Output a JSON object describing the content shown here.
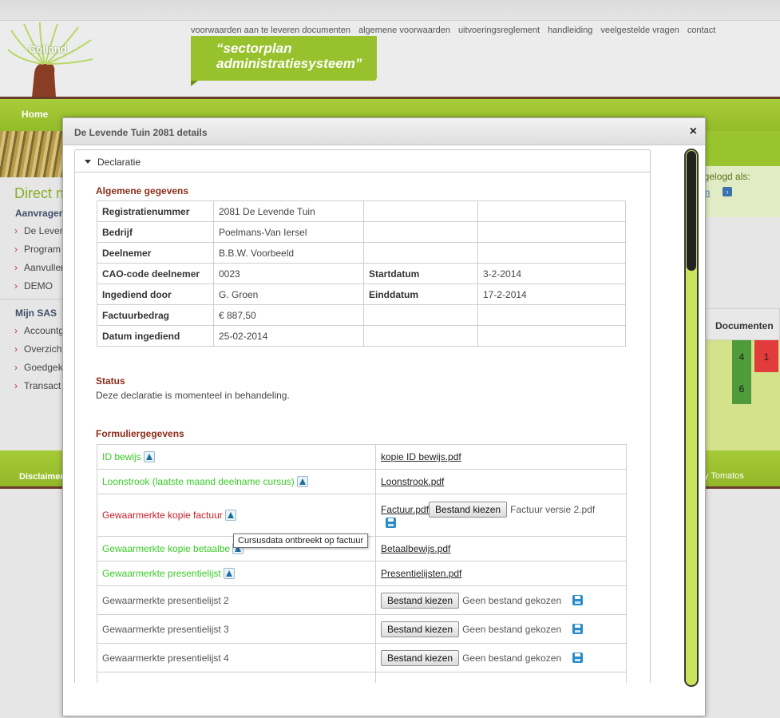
{
  "header": {
    "logo_text": "Colland",
    "topnav": [
      "voorwaarden aan te leveren documenten",
      "algemene voorwaarden",
      "uitvoeringsreglement",
      "handleiding",
      "veelgestelde vragen",
      "contact"
    ],
    "banner_line1": "“sectorplan",
    "banner_line2": "administratiesysteem”",
    "home": "Home"
  },
  "sidebar": {
    "title": "Direct n",
    "group1_head": "Aanvragen",
    "group1_items": [
      "De Leven",
      "Program",
      "Aanvuller",
      "DEMO"
    ],
    "group2_head": "Mijn SAS",
    "group2_items": [
      "Accountg",
      "Overzicht",
      "Goedgek",
      "Transact"
    ]
  },
  "right": {
    "logged_in": "ngelogd als:",
    "link": "en",
    "docs_head": "Documenten",
    "green_count": "4",
    "green_count2": "6",
    "red_count": "1"
  },
  "footer": {
    "disclaimer": "Disclaimer",
    "credit": "y Tomatos"
  },
  "modal": {
    "title": "De Levende Tuin 2081 details",
    "close": "×",
    "panel_title": "Declaratie",
    "general_title": "Algemene gegevens",
    "general_rows": [
      [
        "Registratienummer",
        "2081 De Levende Tuin",
        "",
        ""
      ],
      [
        "Bedrijf",
        "Poelmans-Van Iersel",
        "",
        ""
      ],
      [
        "Deelnemer",
        "B.B.W. Voorbeeld",
        "",
        ""
      ],
      [
        "CAO-code deelnemer",
        "0023",
        "Startdatum",
        "3-2-2014"
      ],
      [
        "Ingediend door",
        "G. Groen",
        "Einddatum",
        "17-2-2014"
      ],
      [
        "Factuurbedrag",
        "€ 887,50",
        "",
        ""
      ],
      [
        "Datum ingediend",
        "25-02-2014",
        "",
        ""
      ]
    ],
    "status_title": "Status",
    "status_text": "Deze declaratie is momenteel in behandeling.",
    "form_title": "Formuliergegevens",
    "form_rows": {
      "r1": {
        "label": "ID bewijs",
        "file": "kopie ID bewijs.pdf"
      },
      "r2": {
        "label": "Loonstrook (laatste maand deelname cursus)",
        "file": "Loonstrook.pdf"
      },
      "r3": {
        "label": "Gewaarmerkte kopie factuur",
        "file": "Factuur.pdf",
        "btn": "Bestand kiezen",
        "chosen": "Factuur versie 2.pdf"
      },
      "r4": {
        "label": "Gewaarmerkte kopie betaalbe",
        "file": "Betaalbewijs.pdf"
      },
      "r5": {
        "label": "Gewaarmerkte presentielijst",
        "file": "Presentielijsten.pdf"
      },
      "r6": {
        "label": "Gewaarmerkte presentielijst 2",
        "btn": "Bestand kiezen",
        "chosen": "Geen bestand gekozen"
      },
      "r7": {
        "label": "Gewaarmerkte presentielijst 3",
        "btn": "Bestand kiezen",
        "chosen": "Geen bestand gekozen"
      },
      "r8": {
        "label": "Gewaarmerkte presentielijst 4",
        "btn": "Bestand kiezen",
        "chosen": "Geen bestand gekozen"
      }
    },
    "tooltip": "Cursusdata ontbreekt op factuur"
  },
  "colors": {
    "accent_green": "#98c22d",
    "brown": "#6b3b2a",
    "section_red": "#8b2b18",
    "valid_green": "#3acb28",
    "invalid_red": "#c8202a"
  }
}
